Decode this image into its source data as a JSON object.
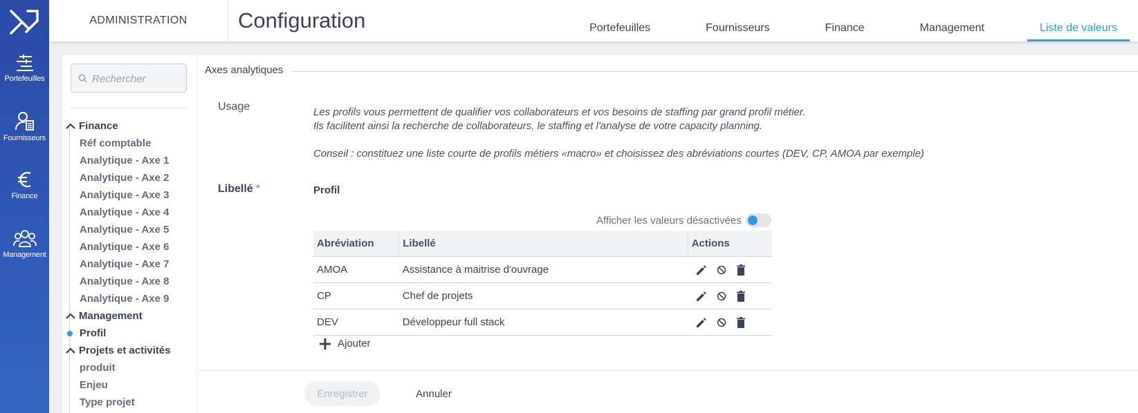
{
  "rail": {
    "items": [
      {
        "label": "Portefeuilles",
        "icon": "portfolio-sliders-icon"
      },
      {
        "label": "Fournisseurs",
        "icon": "supplier-user-icon"
      },
      {
        "label": "Finance",
        "icon": "euro-icon"
      },
      {
        "label": "Management",
        "icon": "team-icon"
      }
    ]
  },
  "header": {
    "section": "ADMINISTRATION",
    "title": "Configuration",
    "tabs": [
      {
        "label": "Portefeuilles"
      },
      {
        "label": "Fournisseurs"
      },
      {
        "label": "Finance"
      },
      {
        "label": "Management"
      },
      {
        "label": "Liste de valeurs",
        "active": true
      }
    ]
  },
  "sidebar": {
    "search_placeholder": "Rechercher",
    "groups": [
      {
        "label": "Finance",
        "items": [
          "Réf comptable",
          "Analytique - Axe 1",
          "Analytique - Axe 2",
          "Analytique - Axe 3",
          "Analytique - Axe 4",
          "Analytique - Axe 5",
          "Analytique - Axe 6",
          "Analytique - Axe 7",
          "Analytique - Axe 8",
          "Analytique - Axe 9"
        ]
      },
      {
        "label": "Management",
        "items": [
          "Profil"
        ]
      },
      {
        "label": "Projets et activités",
        "items": [
          "produit",
          "Enjeu",
          "Type projet"
        ]
      }
    ],
    "selected": "Profil"
  },
  "main": {
    "section_title": "Axes analytiques",
    "usage_label": "Usage",
    "usage_lines": [
      "Les profils vous permettent de qualifier vos collaborateurs et vos besoins de staffing par grand profil métier.",
      "Ils facilitent ainsi la recherche de collaborateurs, le staffing et l'analyse de votre capacity planning.",
      "Conseil : constituez une liste courte de profils métiers «macro» et choisissez des abréviations courtes (DEV, CP, AMOA par exemple)"
    ],
    "libelle_label": "Libellé",
    "required_mark": "*",
    "libelle_value": "Profil",
    "toggle_label": "Afficher les valeurs désactivées",
    "toggle_on": false,
    "table": {
      "headers": [
        "Abréviation",
        "Libellé",
        "Actions"
      ],
      "rows": [
        {
          "abbr": "AMOA",
          "libelle": "Assistance à maitrise d'ouvrage"
        },
        {
          "abbr": "CP",
          "libelle": "Chef de projets"
        },
        {
          "abbr": "DEV",
          "libelle": "Développeur full stack"
        }
      ]
    },
    "add_label": "Ajouter",
    "save_label": "Enregistrer",
    "cancel_label": "Annuler"
  },
  "colors": {
    "rail": "#2f57b6",
    "accent": "#2d9de0",
    "text": "#3c4257"
  }
}
